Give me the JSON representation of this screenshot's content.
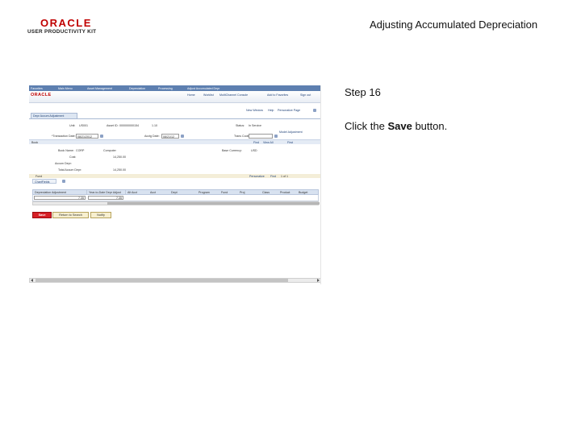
{
  "header": {
    "logo_oracle": "ORACLE",
    "logo_upk": "USER PRODUCTIVITY KIT",
    "slide_title": "Adjusting Accumulated Depreciation"
  },
  "instructions": {
    "step": "Step 16",
    "text_before": "Click the ",
    "text_bold": "Save",
    "text_after": " button."
  },
  "screen": {
    "brand": "ORACLE",
    "nav": [
      "Favorites",
      "Main Menu",
      "Asset Management",
      "Depreciation",
      "Processing",
      "Adjust Accumulated Depr"
    ],
    "header_links": [
      "Home",
      "Worklist",
      "MultiChannel Console",
      "Add to Favorites",
      "Sign out"
    ],
    "page_links": [
      "New Window",
      "Help",
      "Personalize Page"
    ],
    "tab_label": "Depr Accum Adjustment",
    "form": {
      "unit_label": "Unit:",
      "unit_value": "US001",
      "asset_label": "Asset ID:",
      "asset_value": "000000000154",
      "asset_suffix": "1.10",
      "status_label": "Status:",
      "status_value": "In Service",
      "trans_date_label": "*Transaction Date:",
      "trans_date_value": "08/21/2012",
      "acctg_date_label": "Acctg Date:",
      "acctg_date_value": "08/21/12",
      "trans_code_label": "Trans Code:",
      "model_link": "Model Adjustment"
    },
    "section": {
      "book_label": "Book",
      "find_link": "Find",
      "view_all": "View All",
      "first": "First",
      "book_name_label": "Book Name:",
      "book_name_value": "CORP",
      "category_value": "Computer",
      "base_currency_label": "Base Currency:",
      "base_currency_value": "USD",
      "cost_label": "Cost:",
      "cost_value": "14,250.00",
      "accum_label": "Accum Depr:",
      "accum_value": "",
      "total_label": "Total Accum Depr:",
      "total_value": "14,250.00"
    },
    "grid": {
      "title": "Fund",
      "personalize": "Personalize",
      "find": "Find",
      "pager": "1 of 1",
      "tab": "ChartFields",
      "columns": [
        "Depreciation Adjustment",
        "Year-to-Date Depr Adjust",
        "Alt Acct",
        "Acct",
        "Dept",
        "Program",
        "Fund",
        "Proj",
        "Class",
        "Product",
        "Budget"
      ],
      "row": {
        "depr_adjustment": "7.35",
        "ytd_adjustment": "7.35"
      }
    },
    "buttons": {
      "save": "Save",
      "return": "Return to Search",
      "notify": "Notify"
    }
  }
}
